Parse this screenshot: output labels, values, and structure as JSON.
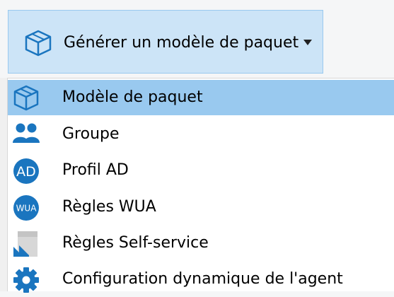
{
  "split_button": {
    "label": "Générer un modèle de paquet",
    "icon": "package-cube-icon",
    "dropdown_icon": "caret-down-icon"
  },
  "menu": {
    "items": [
      {
        "label": "Modèle de paquet",
        "icon": "package-cube-icon",
        "selected": true
      },
      {
        "label": "Groupe",
        "icon": "group-users-icon",
        "selected": false
      },
      {
        "label": "Profil AD",
        "icon": "ad-profile-icon",
        "icon_text": "AD",
        "selected": false
      },
      {
        "label": "Règles WUA",
        "icon": "wua-rules-icon",
        "icon_text": "WUA",
        "selected": false
      },
      {
        "label": "Règles Self-service",
        "icon": "self-service-rules-icon",
        "selected": false
      },
      {
        "label": "Configuration dynamique de l'agent",
        "icon": "gear-icon",
        "selected": false
      }
    ]
  },
  "colors": {
    "accent_blue": "#1a75bf",
    "hover_bg": "#cce4f7",
    "selected_bg": "#99c9ef"
  }
}
